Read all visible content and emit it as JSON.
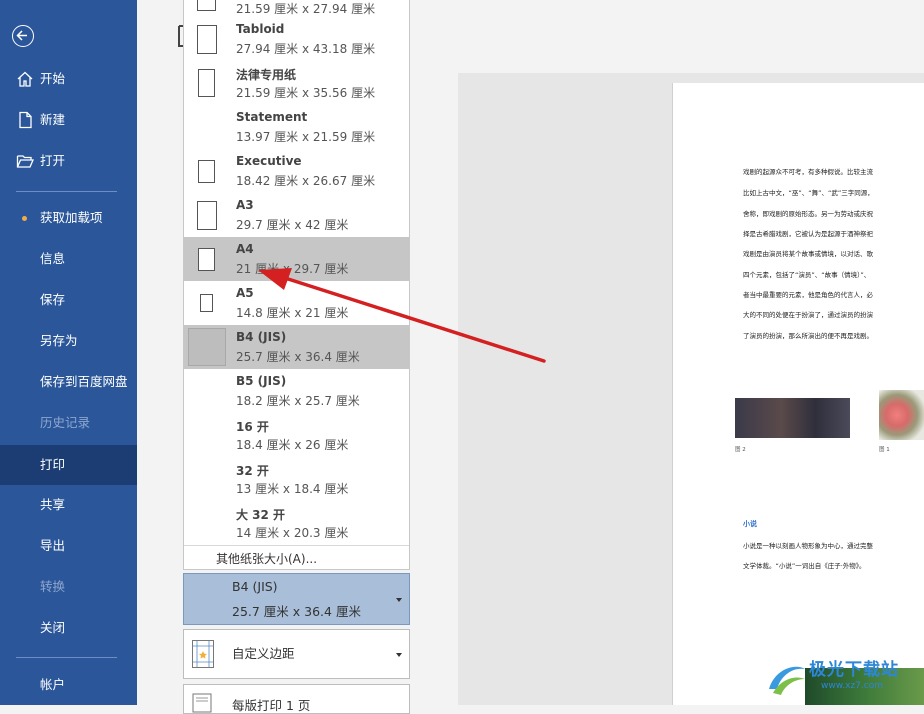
{
  "sidebar": {
    "items": [
      {
        "label": "开始",
        "icon": "home-icon"
      },
      {
        "label": "新建",
        "icon": "new-doc-icon"
      },
      {
        "label": "打开",
        "icon": "folder-open-icon"
      },
      {
        "label": "获取加载项"
      },
      {
        "label": "信息"
      },
      {
        "label": "保存"
      },
      {
        "label": "另存为"
      },
      {
        "label": "保存到百度网盘"
      },
      {
        "label": "历史记录"
      },
      {
        "label": "打印"
      },
      {
        "label": "共享"
      },
      {
        "label": "导出"
      },
      {
        "label": "转换"
      },
      {
        "label": "关闭"
      },
      {
        "label": "帐户"
      }
    ],
    "active": "打印",
    "accent": "#2b579a"
  },
  "paper_sizes": [
    {
      "name": "",
      "dims": "21.59 厘米 x 27.94 厘米"
    },
    {
      "name": "Tabloid",
      "dims": "27.94 厘米 x 43.18 厘米"
    },
    {
      "name": "法律专用纸",
      "dims": "21.59 厘米 x 35.56 厘米"
    },
    {
      "name": "Statement",
      "dims": "13.97 厘米 x 21.59 厘米"
    },
    {
      "name": "Executive",
      "dims": "18.42 厘米 x 26.67 厘米"
    },
    {
      "name": "A3",
      "dims": "29.7 厘米 x 42 厘米"
    },
    {
      "name": "A4",
      "dims": "21 厘米 x 29.7 厘米"
    },
    {
      "name": "A5",
      "dims": "14.8 厘米 x 21 厘米"
    },
    {
      "name": "B4 (JIS)",
      "dims": "25.7 厘米 x 36.4 厘米"
    },
    {
      "name": "B5 (JIS)",
      "dims": "18.2 厘米 x 25.7 厘米"
    },
    {
      "name": "16 开",
      "dims": "18.4 厘米 x 26 厘米"
    },
    {
      "name": "32 开",
      "dims": "13 厘米 x 18.4 厘米"
    },
    {
      "name": "大 32 开",
      "dims": "14 厘米 x 20.3 厘米"
    }
  ],
  "more_sizes": "其他纸张大小(A)...",
  "selected_paper": {
    "name": "B4 (JIS)",
    "dims": "25.7 厘米 x 36.4 厘米"
  },
  "margins": {
    "label": "自定义边距"
  },
  "pages_per_sheet": {
    "label": "每版打印 1 页"
  },
  "document": {
    "lines": [
      "戏剧的起源众不可考，有多种假说。比较主流",
      "比如上古中文，“巫”、“舞”、“武”三字同源，",
      "舍称，即戏剧的原始形态。另一为劳动或庆祝",
      "择是古希腊戏剧，它被认为是起源于酒神祭祀",
      "戏剧是由演员将某个故事或情境，以对话、歌",
      "四个元素，包括了“演员”、“故事（情境）”、",
      "者当中最重要的元素，他是角色的代言人，必",
      "大的不同的处便在于扮演了，通过演员的扮演",
      "了演员的扮演，那么所演出的便不再是戏剧。"
    ],
    "captions": [
      "图 2",
      "图 1"
    ],
    "heading": "小说",
    "lines2": [
      "小说是一种以刻画人物形象为中心，通过完整",
      "文学体裁。“小说”一词出自《庄子·外物》。"
    ]
  },
  "watermark": {
    "text": "极光下载站",
    "url": "www.xz7.com"
  }
}
